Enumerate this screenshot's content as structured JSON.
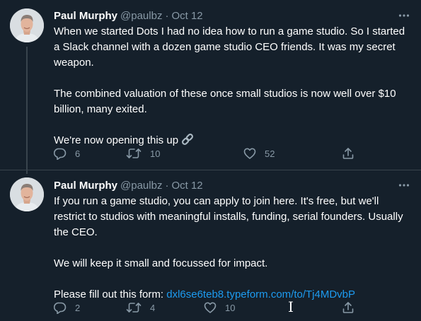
{
  "tweets": [
    {
      "author": {
        "name": "Paul Murphy",
        "handle": "@paulbz",
        "date": "Oct 12"
      },
      "paragraphs": [
        "When we started Dots I had no idea how to run a game studio. So I started a Slack channel with a dozen game studio CEO friends. It was my secret weapon.",
        "The combined valuation of these once small studios is now well over $10 billion, many exited.",
        "We're now opening this up"
      ],
      "actions": {
        "replies": "6",
        "retweets": "10",
        "likes": "52"
      }
    },
    {
      "author": {
        "name": "Paul Murphy",
        "handle": "@paulbz",
        "date": "Oct 12"
      },
      "paragraphs": [
        "If you run a game studio, you can apply to join here. It's free, but we'll restrict to studios with meaningful installs, funding, serial founders. Usually the CEO.",
        "We will keep it small and focussed for impact."
      ],
      "form_prefix": "Please fill out this form: ",
      "form_link": "dxl6se6teb8.typeform.com/to/Tj4MDvbP",
      "actions": {
        "replies": "2",
        "retweets": "4",
        "likes": "10"
      }
    }
  ],
  "separator": "·",
  "icons": [
    "more-icon",
    "reply-icon",
    "retweet-icon",
    "like-icon",
    "share-icon",
    "link-icon",
    "text-cursor-icon"
  ],
  "colors": {
    "background": "#15202b",
    "text": "#ffffff",
    "secondary": "#8899a6",
    "link": "#1d9bf0",
    "divider": "#38444d"
  }
}
